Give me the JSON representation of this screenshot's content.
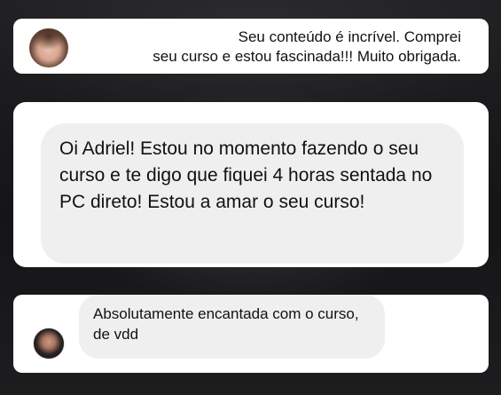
{
  "messages": [
    {
      "author": "left-avatar-1",
      "text": "Seu conteúdo é incrível. Comprei\nseu curso e estou fascinada!!! Muito obrigada."
    },
    {
      "author": "bubble",
      "text": "Oi Adriel! Estou no momento fazendo o seu curso e te digo que fiquei 4 horas sentada no PC direto! Estou a amar o seu curso!"
    },
    {
      "author": "left-avatar-2",
      "text": "Absolutamente encantada com o curso, de vdd"
    }
  ]
}
